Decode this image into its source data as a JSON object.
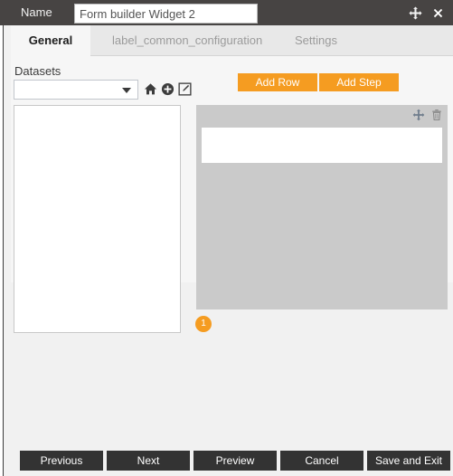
{
  "titlebar": {
    "name_label": "Name",
    "name_value": "Form builder Widget 2",
    "name_placeholder": "",
    "move_icon": "move-icon",
    "close_icon": "close-icon",
    "background_color": "#474443"
  },
  "tabs": [
    {
      "label": "General",
      "active": true
    },
    {
      "label": "label_common_configuration",
      "active": false
    },
    {
      "label": "Settings",
      "active": false
    }
  ],
  "general": {
    "datasets_label": "Datasets",
    "datasets_selected": "",
    "dataset_tools": [
      {
        "icon": "home-icon",
        "name": "dataset-home-button"
      },
      {
        "icon": "plus-circle-icon",
        "name": "dataset-add-button"
      },
      {
        "icon": "edit-pencil-icon",
        "name": "dataset-edit-button"
      }
    ],
    "dataset_list_items": []
  },
  "actions": {
    "add_row_label": "Add Row",
    "add_step_label": "Add Step",
    "accent_color": "#f59c21"
  },
  "step": {
    "move_icon": "move-icon",
    "delete_icon": "trash-icon",
    "badge_number": "1",
    "row_value": "",
    "panel_color": "#cacaca"
  },
  "footer": {
    "buttons": [
      {
        "label": "Previous",
        "name": "previous-button"
      },
      {
        "label": "Next",
        "name": "next-button"
      },
      {
        "label": "Preview",
        "name": "preview-button"
      },
      {
        "label": "Cancel",
        "name": "cancel-button"
      },
      {
        "label": "Save and Exit",
        "name": "save-and-exit-button"
      }
    ],
    "background_color": "#333333"
  }
}
